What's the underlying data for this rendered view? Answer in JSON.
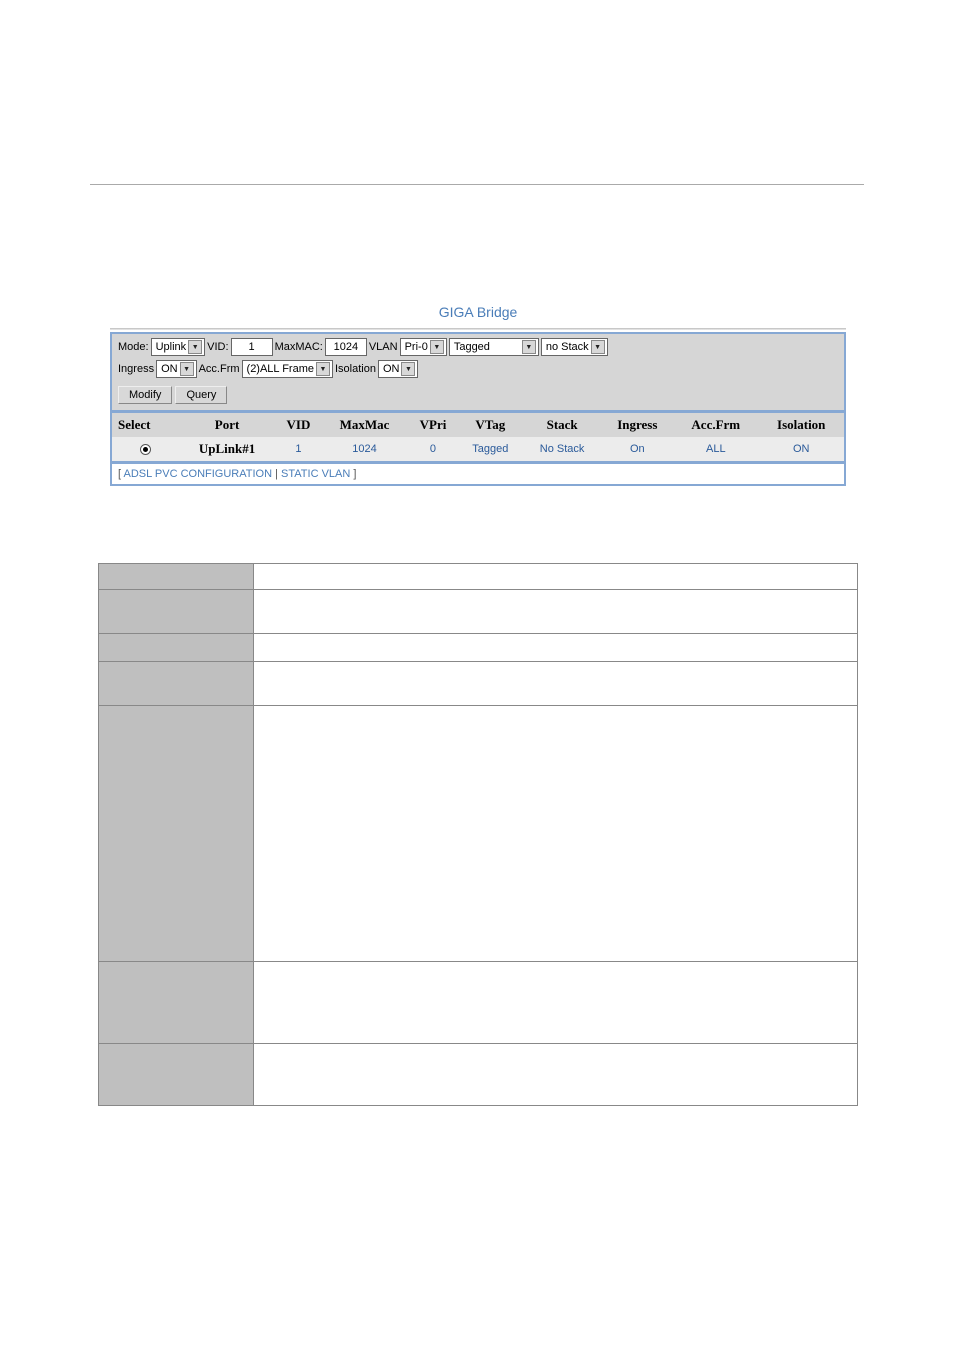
{
  "panel_title": "GIGA Bridge",
  "form": {
    "mode_label": "Mode:",
    "mode_value": "Uplink",
    "vid_label": "VID:",
    "vid_value": "1",
    "maxmac_label": "MaxMAC:",
    "maxmac_value": "1024",
    "vlan_label": "VLAN",
    "vlan_value": "Pri-0",
    "tagged_value": "Tagged",
    "stack_value": "no Stack",
    "ingress_label": "Ingress",
    "ingress_value": "ON",
    "accfrm_label": "Acc.Frm",
    "accfrm_value": "(2)ALL Frame",
    "isolation_label": "Isolation",
    "isolation_value": "ON",
    "modify_btn": "Modify",
    "query_btn": "Query"
  },
  "columns": {
    "select": "Select",
    "port": "Port",
    "vid": "VID",
    "maxmac": "MaxMac",
    "vpri": "VPri",
    "vtag": "VTag",
    "stack": "Stack",
    "ingress": "Ingress",
    "accfrm": "Acc.Frm",
    "isolation": "Isolation"
  },
  "row": {
    "port": "UpLink#1",
    "vid": "1",
    "maxmac": "1024",
    "vpri": "0",
    "vtag": "Tagged",
    "stack": "No Stack",
    "ingress": "On",
    "accfrm": "ALL",
    "isolation": "ON"
  },
  "footer": {
    "open": "[ ",
    "link1": "ADSL PVC CONFIGURATION",
    "sep": " | ",
    "link2": "STATIC VLAN",
    "close": " ]"
  }
}
